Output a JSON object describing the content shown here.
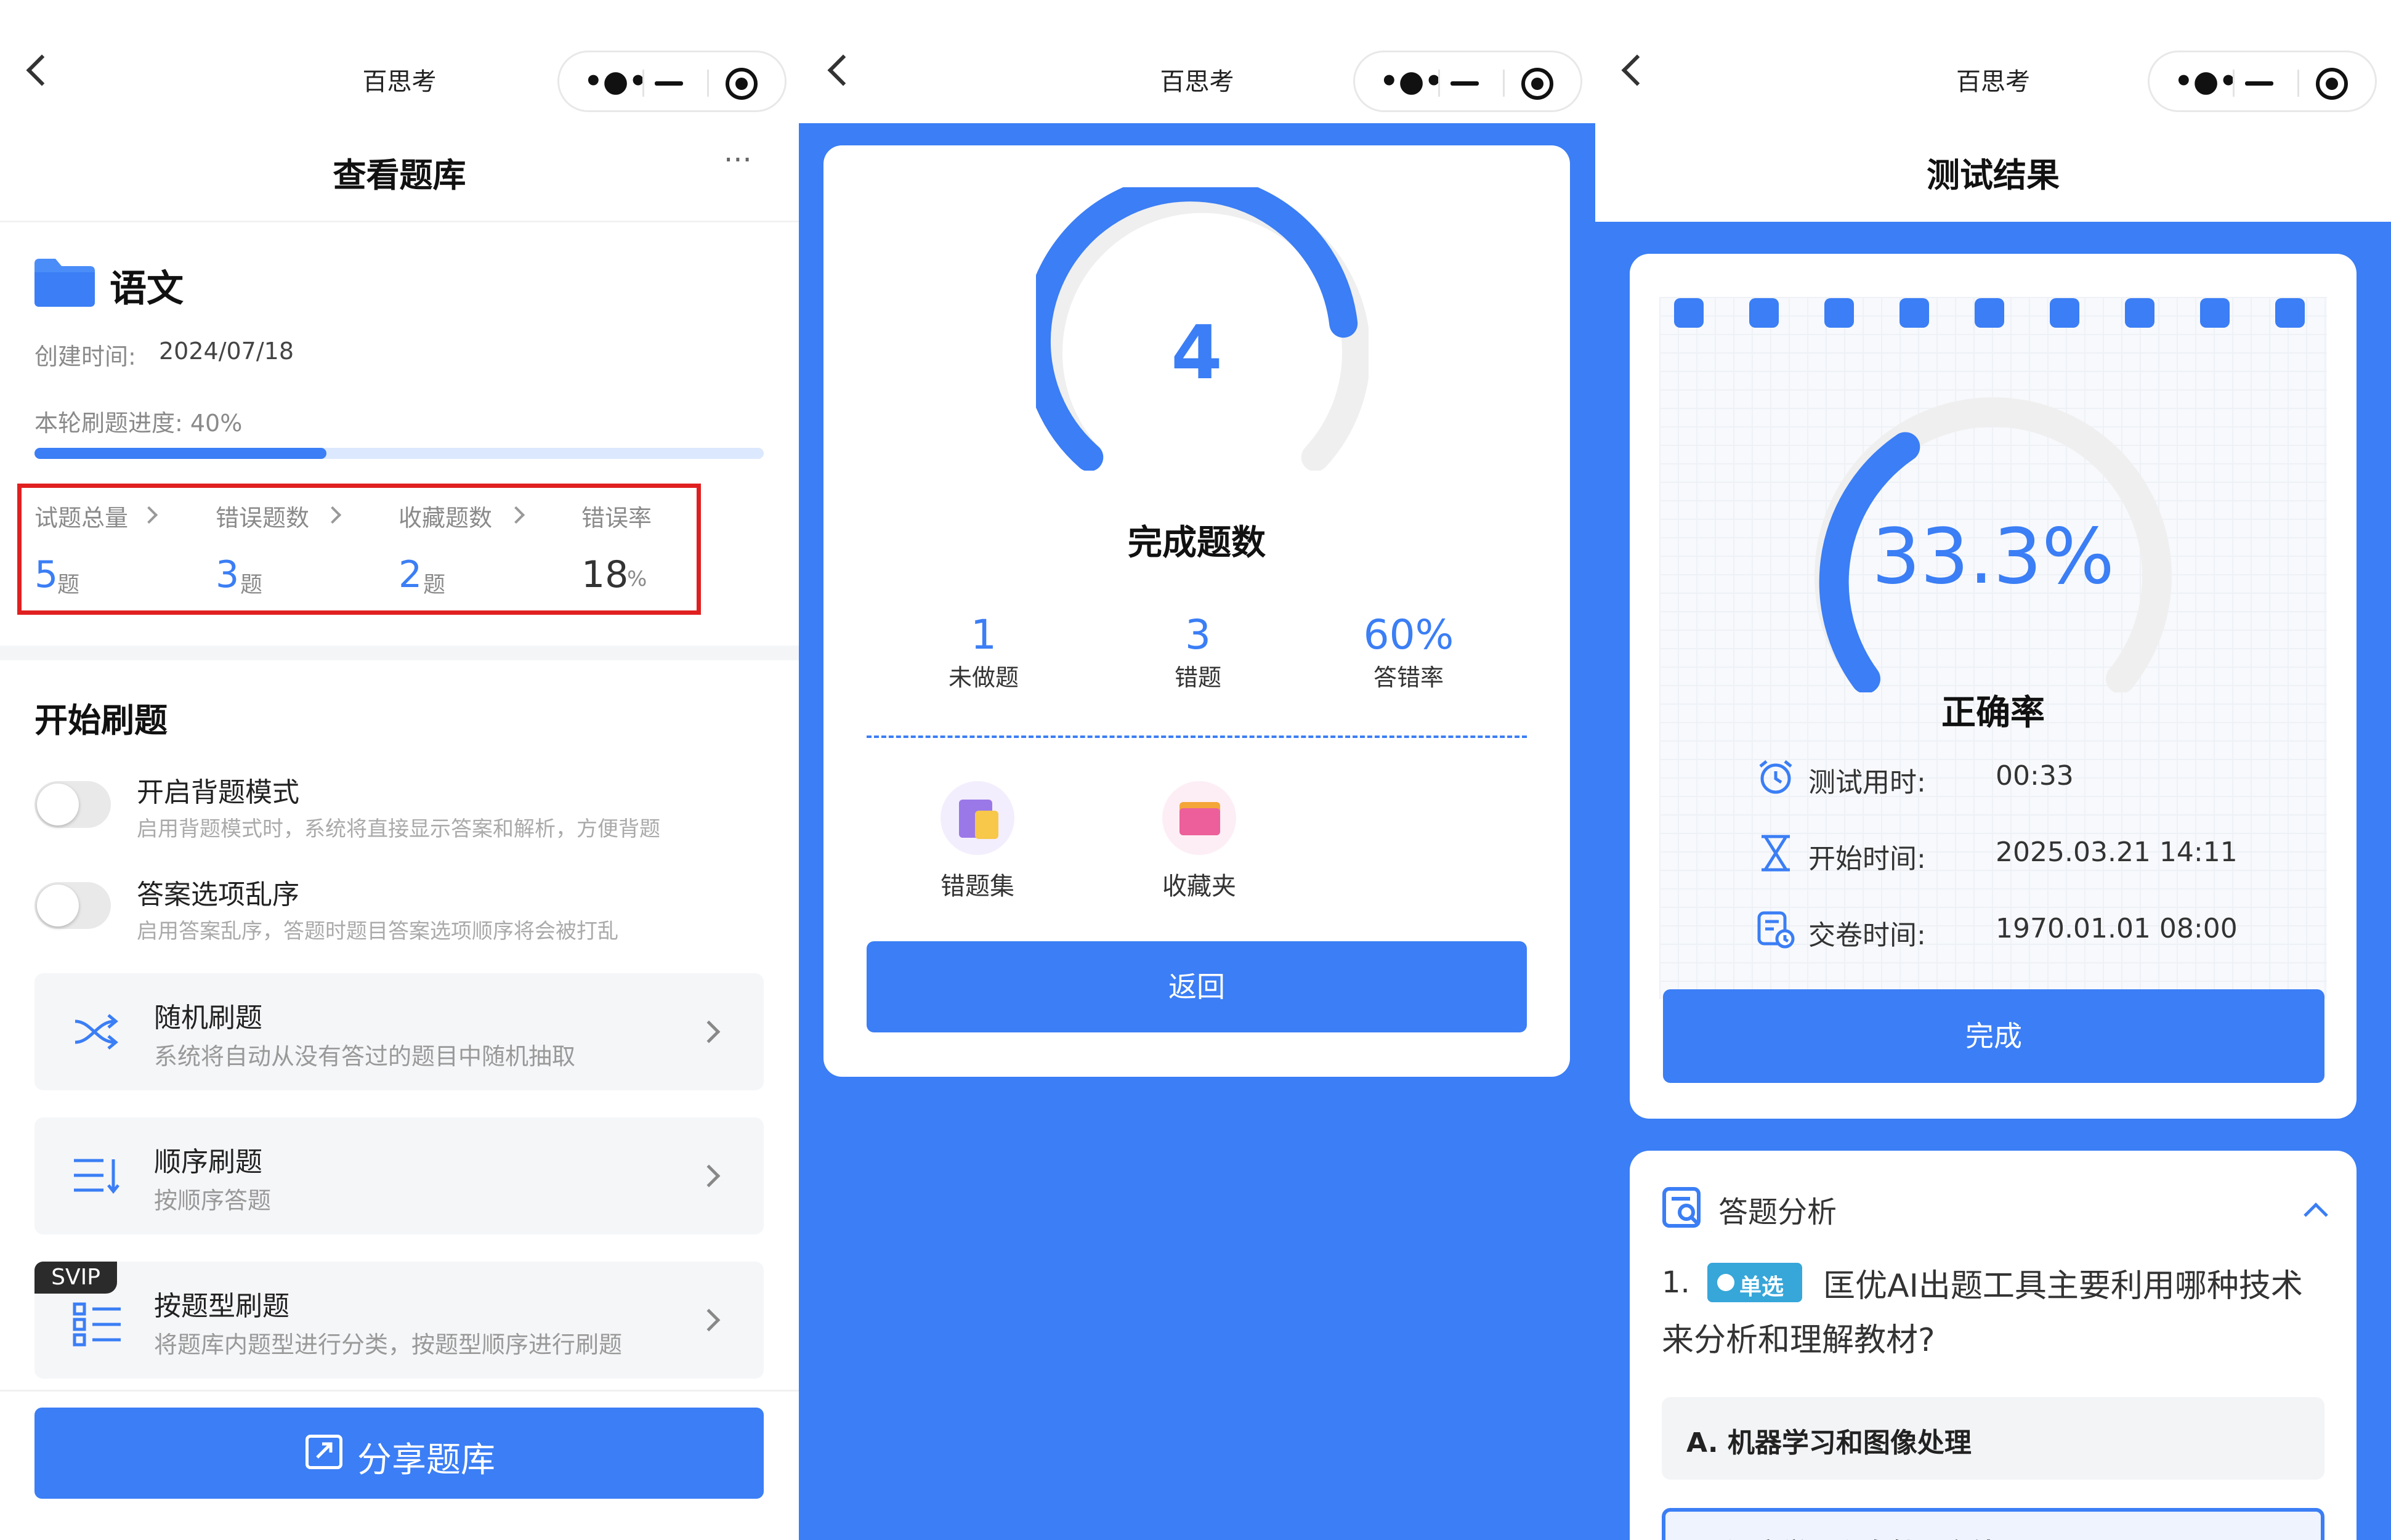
{
  "app_name": "百思考",
  "left": {
    "title": "查看题库",
    "menu": "···",
    "folder_name": "语文",
    "created_label": "创建时间:",
    "created_value": "2024/07/18",
    "progress_label": "本轮刷题进度: 40%",
    "progress_value": 0.4,
    "stats": [
      {
        "label": "试题总量",
        "value": "5",
        "unit": "题"
      },
      {
        "label": "错误题数",
        "value": "3",
        "unit": "题"
      },
      {
        "label": "收藏题数",
        "value": "2",
        "unit": "题"
      },
      {
        "label": "错误率",
        "value": "18",
        "unit": "%"
      }
    ],
    "section_title": "开始刷题",
    "toggles": [
      {
        "title": "开启背题模式",
        "desc": "启用背题模式时，系统将直接显示答案和解析，方便背题"
      },
      {
        "title": "答案选项乱序",
        "desc": "启用答案乱序，答题时题目答案选项顺序将会被打乱"
      }
    ],
    "modes": [
      {
        "title": "随机刷题",
        "desc": "系统将自动从没有答过的题目中随机抽取",
        "icon": "shuffle-icon"
      },
      {
        "title": "顺序刷题",
        "desc": "按顺序答题",
        "icon": "sort-icon"
      },
      {
        "title": "按题型刷题",
        "desc": "将题库内题型进行分类，按题型顺序进行刷题",
        "icon": "list-icon",
        "badge": "SVIP"
      }
    ],
    "share_button": "分享题库"
  },
  "middle": {
    "count": "4",
    "count_label": "完成题数",
    "stats": [
      {
        "value": "1",
        "label": "未做题"
      },
      {
        "value": "3",
        "label": "错题"
      },
      {
        "value": "60%",
        "label": "答错率"
      }
    ],
    "links": [
      {
        "label": "错题集",
        "icon": "wrong-book-icon"
      },
      {
        "label": "收藏夹",
        "icon": "favorite-folder-icon"
      }
    ],
    "return_button": "返回"
  },
  "right": {
    "title": "测试结果",
    "rate": "33.3%",
    "rate_value": 0.333,
    "rate_label": "正确率",
    "rows": [
      {
        "label": "测试用时:",
        "value": "00:33",
        "icon": "alarm-clock-icon"
      },
      {
        "label": "开始时间:",
        "value": "2025.03.21 14:11",
        "icon": "hourglass-icon"
      },
      {
        "label": "交卷时间:",
        "value": "1970.01.01 08:00",
        "icon": "paper-clock-icon"
      }
    ],
    "done_button": "完成",
    "analysis_title": "答题分析",
    "question_number": "1.",
    "question_tag": "单选",
    "question_text": "匡优AI出题工具主要利用哪种技术来分析和理解教材?",
    "option_a": "A. 机器学习和图像处理",
    "option_b": "B. 深度学习和自然语言处理"
  },
  "colors": {
    "accent": "#3b7ef5",
    "highlight_border": "#e02020"
  }
}
